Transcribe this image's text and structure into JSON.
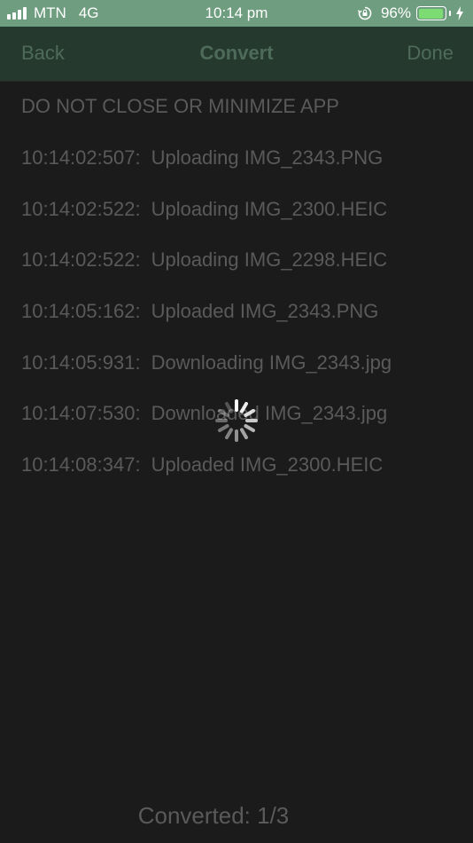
{
  "status_bar": {
    "carrier": "MTN",
    "network": "4G",
    "time": "10:14 pm",
    "battery_percent": "96%",
    "battery_level": 0.96,
    "icons": [
      "signal-icon",
      "orientation-lock-icon",
      "battery-icon",
      "charging-bolt-icon"
    ]
  },
  "nav": {
    "back_label": "Back",
    "title": "Convert",
    "done_label": "Done"
  },
  "warning": "DO NOT CLOSE OR MINIMIZE APP",
  "log": [
    {
      "time": "10:14:02:507:",
      "message": "Uploading IMG_2343.PNG"
    },
    {
      "time": "10:14:02:522:",
      "message": "Uploading IMG_2300.HEIC"
    },
    {
      "time": "10:14:02:522:",
      "message": "Uploading IMG_2298.HEIC"
    },
    {
      "time": "10:14:05:162:",
      "message": "Uploaded IMG_2343.PNG"
    },
    {
      "time": "10:14:05:931:",
      "message": "Downloading IMG_2343.jpg"
    },
    {
      "time": "10:14:07:530:",
      "message": "Downloaded IMG_2343.jpg"
    },
    {
      "time": "10:14:08:347:",
      "message": "Uploaded IMG_2300.HEIC"
    }
  ],
  "footer": {
    "converted_text": "Converted: 1/3"
  },
  "colors": {
    "status_bar_bg": "#6f9d7f",
    "nav_bg": "#26392f",
    "nav_text": "#4e6b5a",
    "background": "#1b1b1b",
    "text": "#5a5a5a",
    "battery_fill": "#7cdb72"
  }
}
